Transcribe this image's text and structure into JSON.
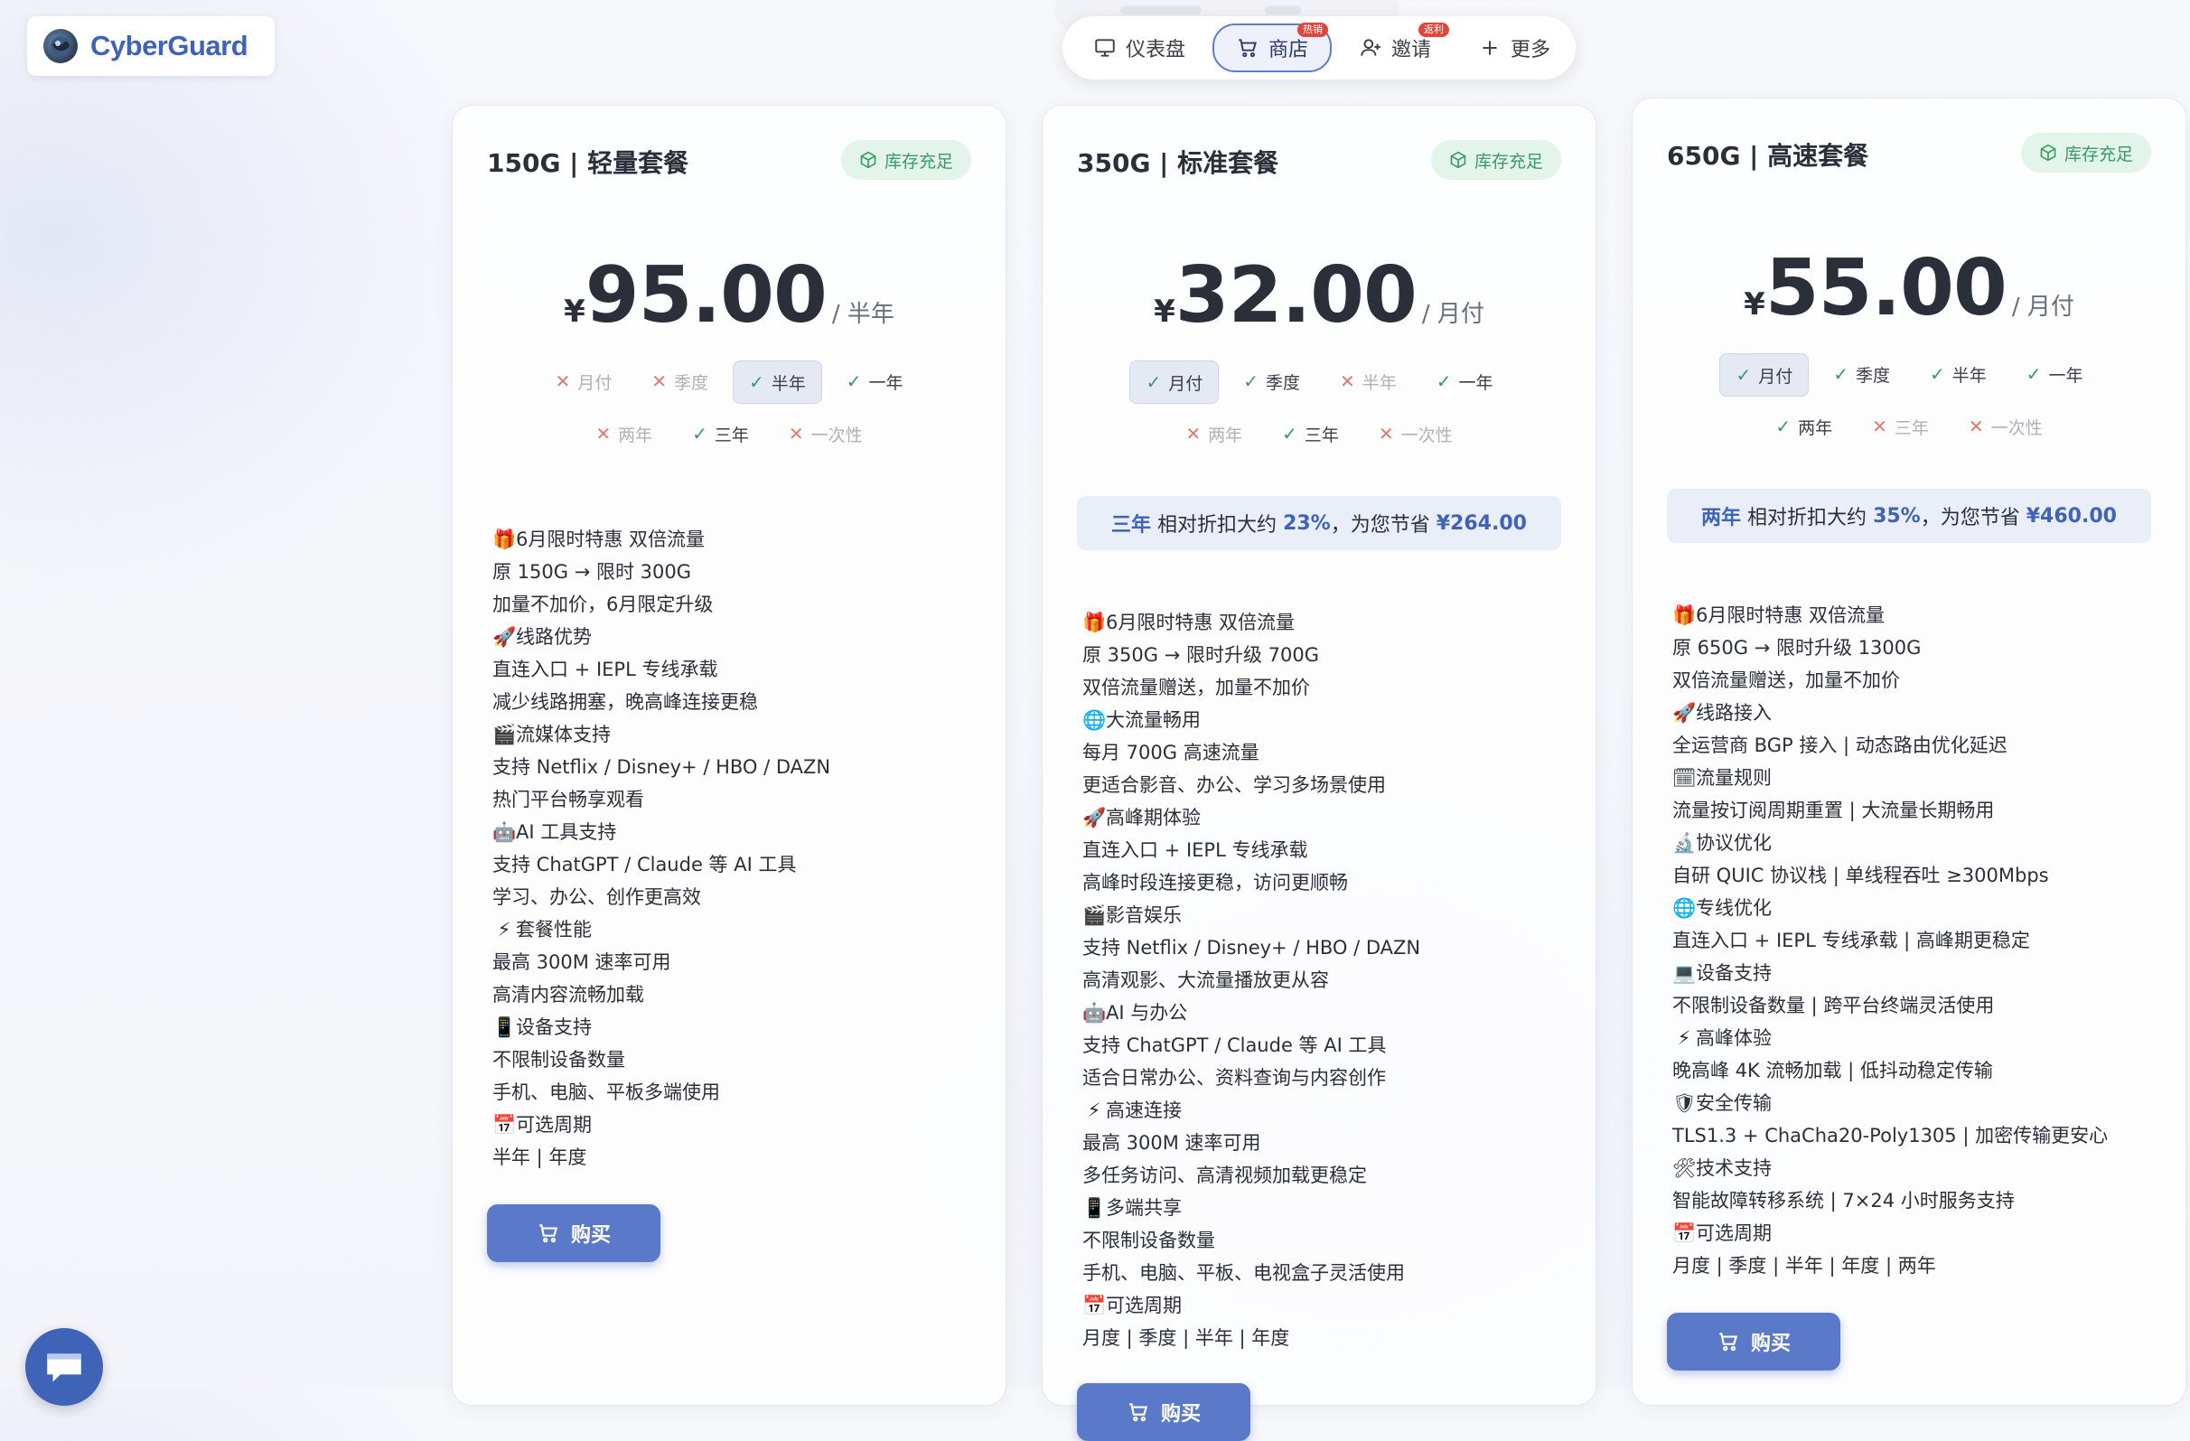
{
  "brand": {
    "name": "CyberGuard",
    "logo_icon": "globe-logo-icon"
  },
  "nav": {
    "items": [
      {
        "label": "仪表盘",
        "icon": "monitor-icon",
        "badge": null,
        "active": false
      },
      {
        "label": "商店",
        "icon": "cart-icon",
        "badge": "热销",
        "active": true
      },
      {
        "label": "邀请",
        "icon": "user-plus-icon",
        "badge": "返利",
        "active": false
      },
      {
        "label": "更多",
        "icon": "plus-icon",
        "badge": null,
        "active": false
      }
    ]
  },
  "colors": {
    "accent": "#5b79c9",
    "brand": "#3f63b6",
    "stock_green": "#3a9a68",
    "badge_red": "#e2453c"
  },
  "plans": [
    {
      "title": "150G | 轻量套餐",
      "stock": "库存充足",
      "currency": "¥",
      "price": "95.00",
      "period": "/ 半年",
      "cycles_row1": [
        {
          "label": "月付",
          "available": false,
          "selected": false
        },
        {
          "label": "季度",
          "available": false,
          "selected": false
        },
        {
          "label": "半年",
          "available": true,
          "selected": true
        },
        {
          "label": "一年",
          "available": true,
          "selected": false
        }
      ],
      "cycles_row2": [
        {
          "label": "两年",
          "available": false,
          "selected": false
        },
        {
          "label": "三年",
          "available": true,
          "selected": false
        },
        {
          "label": "一次性",
          "available": false,
          "selected": false
        }
      ],
      "savings": null,
      "features": [
        {
          "emoji": "🎁",
          "text": "6月限时特惠 双倍流量"
        },
        {
          "emoji": "",
          "text": "原 150G → 限时 300G"
        },
        {
          "emoji": "",
          "text": "加量不加价，6月限定升级"
        },
        {
          "emoji": "🚀",
          "text": "线路优势"
        },
        {
          "emoji": "",
          "text": "直连入口 + IEPL 专线承载"
        },
        {
          "emoji": "",
          "text": "减少线路拥塞，晚高峰连接更稳"
        },
        {
          "emoji": "🎬",
          "text": "流媒体支持"
        },
        {
          "emoji": "",
          "text": "支持 Netflix / Disney+ / HBO / DAZN"
        },
        {
          "emoji": "",
          "text": "热门平台畅享观看"
        },
        {
          "emoji": "🤖",
          "text": "AI 工具支持"
        },
        {
          "emoji": "",
          "text": "支持 ChatGPT / Claude 等 AI 工具"
        },
        {
          "emoji": "",
          "text": "学习、办公、创作更高效"
        },
        {
          "emoji": "⚡",
          "text": "套餐性能"
        },
        {
          "emoji": "",
          "text": "最高 300M 速率可用"
        },
        {
          "emoji": "",
          "text": "高清内容流畅加载"
        },
        {
          "emoji": "📱",
          "text": "设备支持"
        },
        {
          "emoji": "",
          "text": "不限制设备数量"
        },
        {
          "emoji": "",
          "text": "手机、电脑、平板多端使用"
        },
        {
          "emoji": "📅",
          "text": "可选周期"
        },
        {
          "emoji": "",
          "text": "半年 | 年度"
        }
      ],
      "buy_label": "购买"
    },
    {
      "title": "350G | 标准套餐",
      "stock": "库存充足",
      "currency": "¥",
      "price": "32.00",
      "period": "/ 月付",
      "cycles_row1": [
        {
          "label": "月付",
          "available": true,
          "selected": true
        },
        {
          "label": "季度",
          "available": true,
          "selected": false
        },
        {
          "label": "半年",
          "available": false,
          "selected": false
        },
        {
          "label": "一年",
          "available": true,
          "selected": false
        }
      ],
      "cycles_row2": [
        {
          "label": "两年",
          "available": false,
          "selected": false
        },
        {
          "label": "三年",
          "available": true,
          "selected": false
        },
        {
          "label": "一次性",
          "available": false,
          "selected": false
        }
      ],
      "savings": {
        "cycle": "三年",
        "text_a": "相对折扣大约",
        "percent": "23%",
        "text_b": "，为您节省",
        "amount": "¥264.00"
      },
      "features": [
        {
          "emoji": "🎁",
          "text": "6月限时特惠 双倍流量"
        },
        {
          "emoji": "",
          "text": "原 350G → 限时升级 700G"
        },
        {
          "emoji": "",
          "text": "双倍流量赠送，加量不加价"
        },
        {
          "emoji": "🌐",
          "text": "大流量畅用"
        },
        {
          "emoji": "",
          "text": "每月 700G 高速流量"
        },
        {
          "emoji": "",
          "text": "更适合影音、办公、学习多场景使用"
        },
        {
          "emoji": "🚀",
          "text": "高峰期体验"
        },
        {
          "emoji": "",
          "text": "直连入口 + IEPL 专线承载"
        },
        {
          "emoji": "",
          "text": "高峰时段连接更稳，访问更顺畅"
        },
        {
          "emoji": "🎬",
          "text": "影音娱乐"
        },
        {
          "emoji": "",
          "text": "支持 Netflix / Disney+ / HBO / DAZN"
        },
        {
          "emoji": "",
          "text": "高清观影、大流量播放更从容"
        },
        {
          "emoji": "🤖",
          "text": "AI 与办公"
        },
        {
          "emoji": "",
          "text": "支持 ChatGPT / Claude 等 AI 工具"
        },
        {
          "emoji": "",
          "text": "适合日常办公、资料查询与内容创作"
        },
        {
          "emoji": "⚡",
          "text": "高速连接"
        },
        {
          "emoji": "",
          "text": "最高 300M 速率可用"
        },
        {
          "emoji": "",
          "text": "多任务访问、高清视频加载更稳定"
        },
        {
          "emoji": "📱",
          "text": "多端共享"
        },
        {
          "emoji": "",
          "text": "不限制设备数量"
        },
        {
          "emoji": "",
          "text": "手机、电脑、平板、电视盒子灵活使用"
        },
        {
          "emoji": "📅",
          "text": "可选周期"
        },
        {
          "emoji": "",
          "text": "月度 | 季度 | 半年 | 年度"
        }
      ],
      "buy_label": "购买"
    },
    {
      "title": "650G | 高速套餐",
      "stock": "库存充足",
      "currency": "¥",
      "price": "55.00",
      "period": "/ 月付",
      "cycles_row1": [
        {
          "label": "月付",
          "available": true,
          "selected": true
        },
        {
          "label": "季度",
          "available": true,
          "selected": false
        },
        {
          "label": "半年",
          "available": true,
          "selected": false
        },
        {
          "label": "一年",
          "available": true,
          "selected": false
        }
      ],
      "cycles_row2": [
        {
          "label": "两年",
          "available": true,
          "selected": false
        },
        {
          "label": "三年",
          "available": false,
          "selected": false
        },
        {
          "label": "一次性",
          "available": false,
          "selected": false
        }
      ],
      "savings": {
        "cycle": "两年",
        "text_a": "相对折扣大约",
        "percent": "35%",
        "text_b": "，为您节省",
        "amount": "¥460.00"
      },
      "features": [
        {
          "emoji": "🎁",
          "text": "6月限时特惠 双倍流量"
        },
        {
          "emoji": "",
          "text": "原 650G → 限时升级 1300G"
        },
        {
          "emoji": "",
          "text": "双倍流量赠送，加量不加价"
        },
        {
          "emoji": "🚀",
          "text": "线路接入"
        },
        {
          "emoji": "",
          "text": "全运营商 BGP 接入 | 动态路由优化延迟"
        },
        {
          "emoji": "🗓",
          "text": "流量规则"
        },
        {
          "emoji": "",
          "text": "流量按订阅周期重置 | 大流量长期畅用"
        },
        {
          "emoji": "🔬",
          "text": "协议优化"
        },
        {
          "emoji": "",
          "text": "自研 QUIC 协议栈 | 单线程吞吐 ≥300Mbps"
        },
        {
          "emoji": "🌐",
          "text": "专线优化"
        },
        {
          "emoji": "",
          "text": "直连入口 + IEPL 专线承载 | 高峰期更稳定"
        },
        {
          "emoji": "💻",
          "text": "设备支持"
        },
        {
          "emoji": "",
          "text": "不限制设备数量 | 跨平台终端灵活使用"
        },
        {
          "emoji": "⚡",
          "text": "高峰体验"
        },
        {
          "emoji": "",
          "text": "晚高峰 4K 流畅加载 | 低抖动稳定传输"
        },
        {
          "emoji": "🛡",
          "text": "安全传输"
        },
        {
          "emoji": "",
          "text": "TLS1.3 + ChaCha20-Poly1305 | 加密传输更安心"
        },
        {
          "emoji": "🛠",
          "text": "技术支持"
        },
        {
          "emoji": "",
          "text": "智能故障转移系统 | 7×24 小时服务支持"
        },
        {
          "emoji": "📅",
          "text": "可选周期"
        },
        {
          "emoji": "",
          "text": "月度 | 季度 | 半年 | 年度 | 两年"
        }
      ],
      "buy_label": "购买"
    }
  ],
  "chat": {
    "icon": "chat-bubble-icon"
  }
}
